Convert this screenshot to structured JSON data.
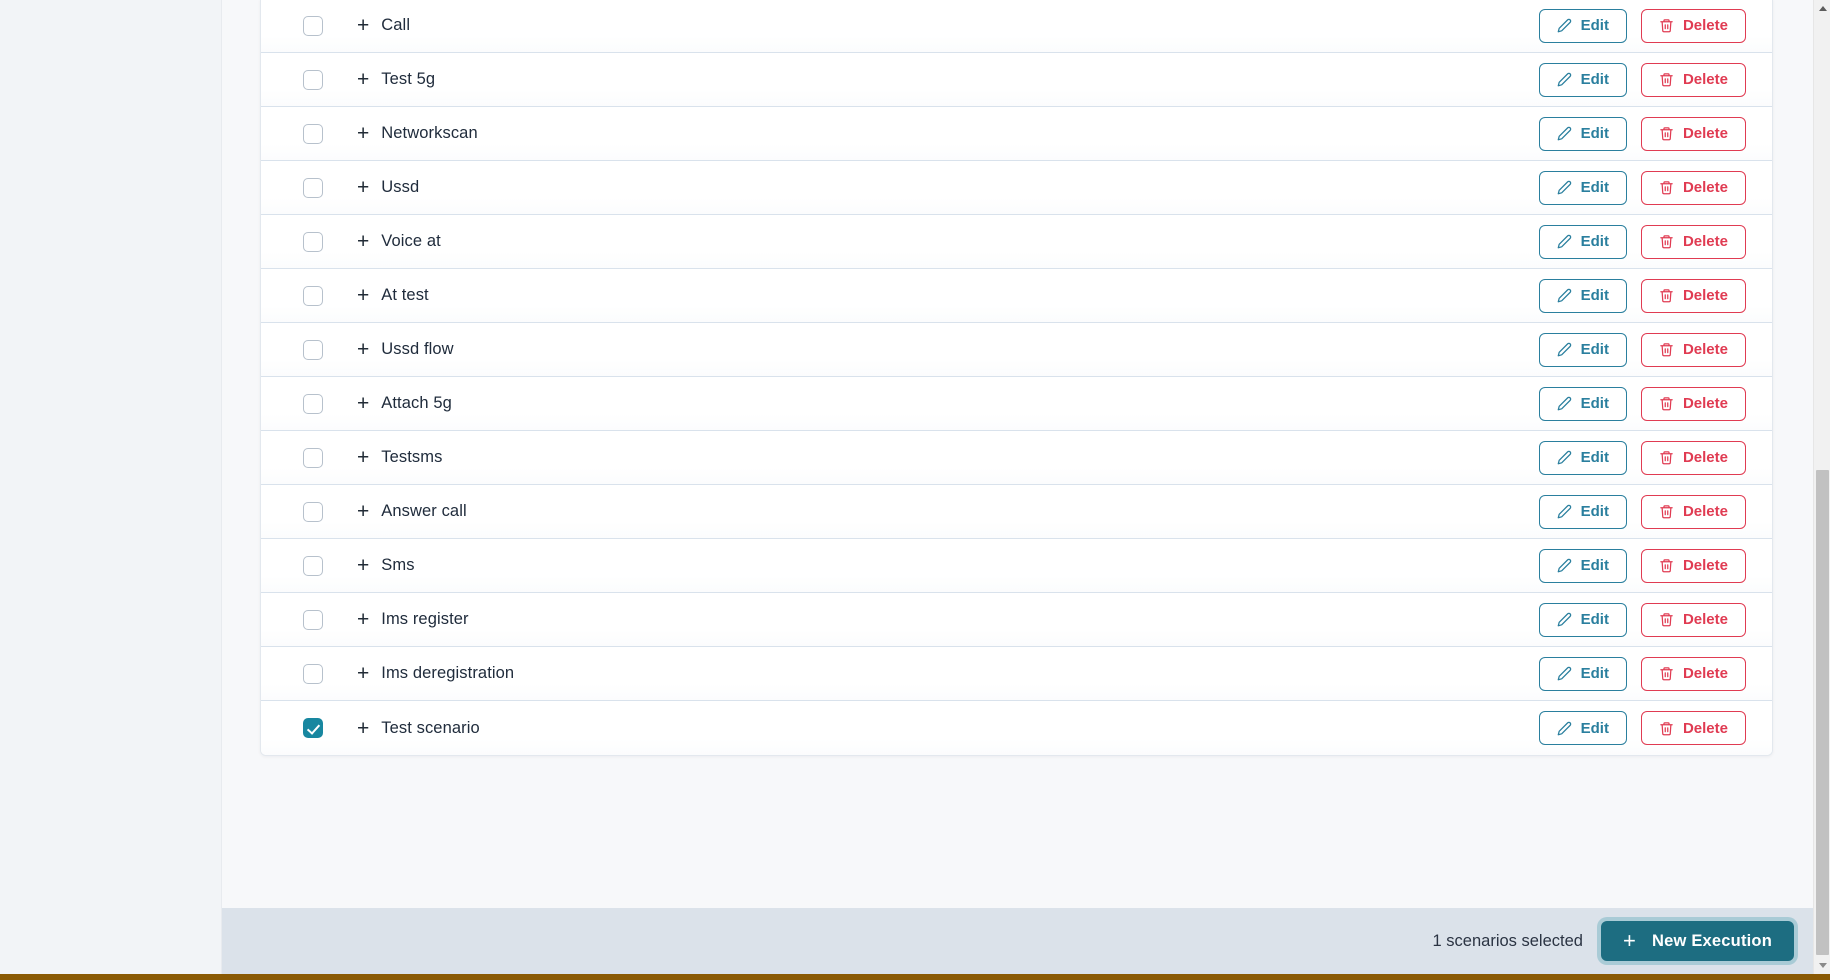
{
  "scenarios": {
    "rows": [
      {
        "label": "Call",
        "checked": false,
        "expand": "+"
      },
      {
        "label": "Test 5g",
        "checked": false,
        "expand": "+"
      },
      {
        "label": "Networkscan",
        "checked": false,
        "expand": "+"
      },
      {
        "label": "Ussd",
        "checked": false,
        "expand": "+"
      },
      {
        "label": "Voice at",
        "checked": false,
        "expand": "+"
      },
      {
        "label": "At test",
        "checked": false,
        "expand": "+"
      },
      {
        "label": "Ussd flow",
        "checked": false,
        "expand": "+"
      },
      {
        "label": "Attach 5g",
        "checked": false,
        "expand": "+"
      },
      {
        "label": "Testsms",
        "checked": false,
        "expand": "+"
      },
      {
        "label": "Answer call",
        "checked": false,
        "expand": "+"
      },
      {
        "label": "Sms",
        "checked": false,
        "expand": "+"
      },
      {
        "label": "Ims register",
        "checked": false,
        "expand": "+"
      },
      {
        "label": "Ims deregistration",
        "checked": false,
        "expand": "+"
      },
      {
        "label": "Test scenario",
        "checked": true,
        "expand": "+"
      }
    ],
    "edit_label": "Edit",
    "delete_label": "Delete",
    "edit_icon": "pencil-icon",
    "delete_icon": "trash-icon"
  },
  "bottom_bar": {
    "selected_text": "1 scenarios selected",
    "new_execution_label": "New Execution",
    "new_execution_plus": "+"
  },
  "scrollbar": {
    "up_arrow_icon": "chevron-up-icon",
    "down_arrow_icon": "chevron-down-icon"
  },
  "colors": {
    "accent_teal": "#1d6d81",
    "checkbox_checked": "#1887a0",
    "edit_blue": "#2a7f9e",
    "delete_red": "#e03b52",
    "bottom_bar_bg": "#dbe2ea",
    "sidebar_bg": "#f2f4f7",
    "accent_strip": "#8a5a05"
  }
}
